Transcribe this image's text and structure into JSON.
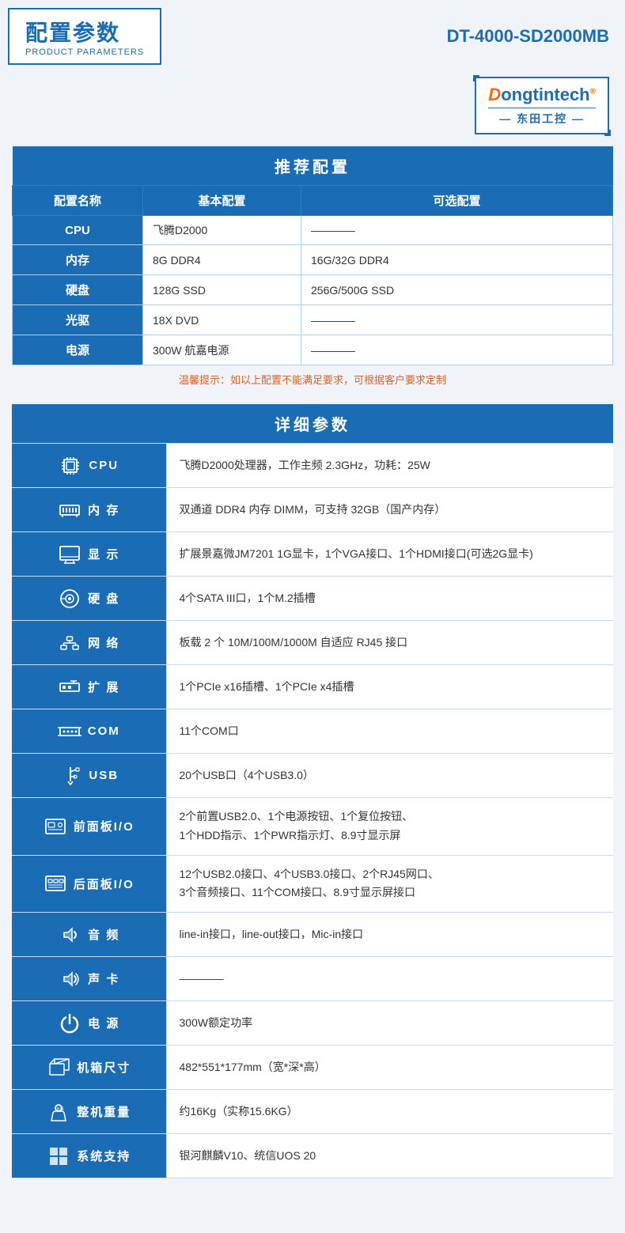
{
  "header": {
    "title": "配置参数",
    "subtitle": "PRODUCT PARAMETERS",
    "model": "DT-4000-SD2000MB"
  },
  "logo": {
    "brand": "Dongtintech",
    "chinese": "— 东田工控 —",
    "reg": "®"
  },
  "recommend": {
    "section_title": "推荐配置",
    "col1": "配置名称",
    "col2": "基本配置",
    "col3": "可选配置",
    "rows": [
      {
        "name": "CPU",
        "basic": "飞腾D2000",
        "optional": "————"
      },
      {
        "name": "内存",
        "basic": "8G DDR4",
        "optional": "16G/32G DDR4"
      },
      {
        "name": "硬盘",
        "basic": "128G SSD",
        "optional": "256G/500G SSD"
      },
      {
        "name": "光驱",
        "basic": "18X DVD",
        "optional": "————"
      },
      {
        "name": "电源",
        "basic": "300W 航嘉电源",
        "optional": "————"
      }
    ],
    "warm_tip": "温馨提示：如以上配置不能满足要求，可根据客户要求定制"
  },
  "detail": {
    "section_title": "详细参数",
    "rows": [
      {
        "icon": "cpu",
        "label": "CPU",
        "value": "飞腾D2000处理器，工作主频 2.3GHz，功耗：25W"
      },
      {
        "icon": "memory",
        "label": "内 存",
        "value": "双通道 DDR4 内存 DIMM，可支持 32GB（国产内存）"
      },
      {
        "icon": "display",
        "label": "显 示",
        "value": "扩展景嘉微JM7201 1G显卡，1个VGA接口、1个HDMI接口(可选2G显卡)"
      },
      {
        "icon": "hdd",
        "label": "硬 盘",
        "value": "4个SATA III口，1个M.2插槽"
      },
      {
        "icon": "network",
        "label": "网 络",
        "value": "板载 2 个 10M/100M/1000M 自适应 RJ45 接口"
      },
      {
        "icon": "expand",
        "label": "扩 展",
        "value": "1个PCIe x16插槽、1个PCIe x4插槽"
      },
      {
        "icon": "com",
        "label": "COM",
        "value": "11个COM口"
      },
      {
        "icon": "usb",
        "label": "USB",
        "value": "20个USB口（4个USB3.0）"
      },
      {
        "icon": "front",
        "label": "前面板I/O",
        "value": "2个前置USB2.0、1个电源按钮、1个复位按钮、\n1个HDD指示、1个PWR指示灯、8.9寸显示屏"
      },
      {
        "icon": "back",
        "label": "后面板I/O",
        "value": "12个USB2.0接口、4个USB3.0接口、2个RJ45网口、\n3个音频接口、11个COM接口、8.9寸显示屏接口"
      },
      {
        "icon": "audio",
        "label": "音 频",
        "value": "line-in接口，line-out接口，Mic-in接口"
      },
      {
        "icon": "soundcard",
        "label": "声 卡",
        "value": "————"
      },
      {
        "icon": "power",
        "label": "电 源",
        "value": "300W额定功率"
      },
      {
        "icon": "chassis",
        "label": "机箱尺寸",
        "value": "482*551*177mm（宽*深*高）"
      },
      {
        "icon": "weight",
        "label": "整机重量",
        "value": "约16Kg（实称15.6KG）"
      },
      {
        "icon": "os",
        "label": "系统支持",
        "value": "银河麒麟V10、统信UOS 20"
      }
    ]
  }
}
